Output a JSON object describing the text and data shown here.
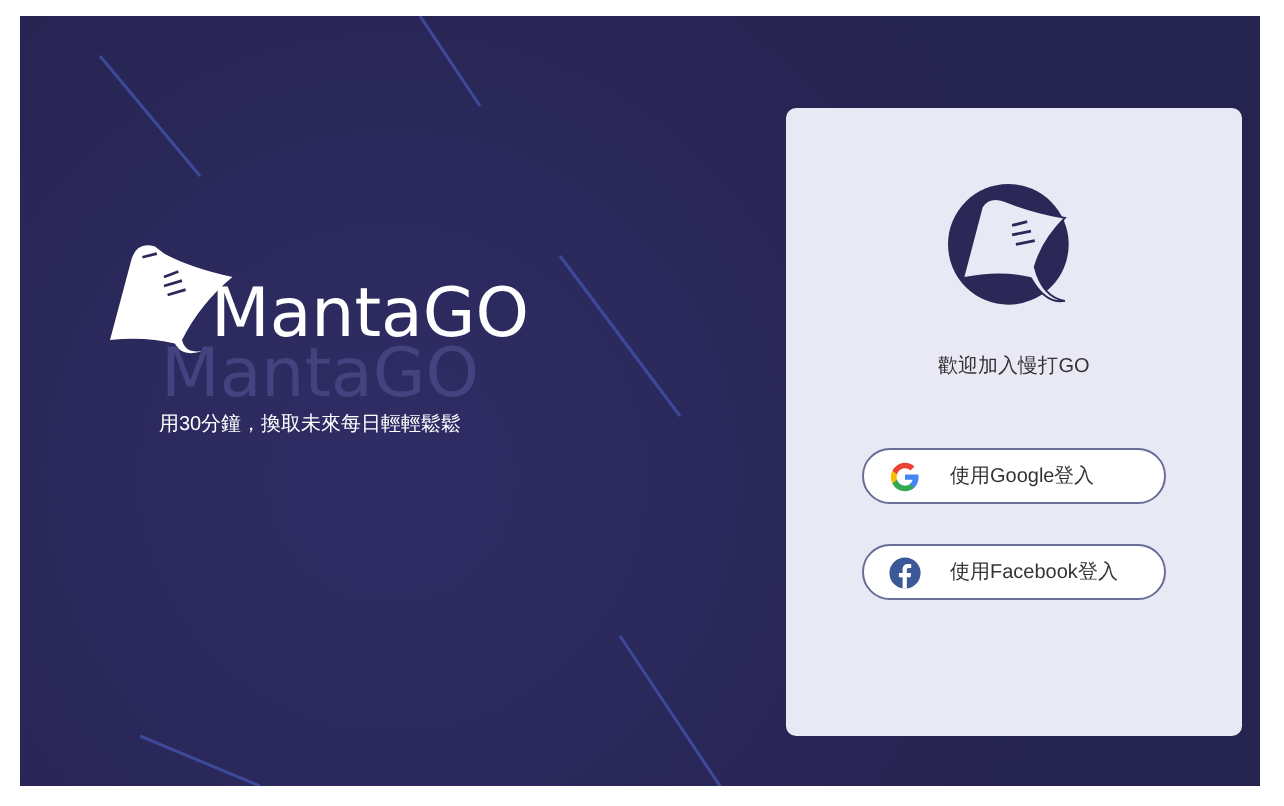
{
  "brand": {
    "name": "MantaGO",
    "echo": "MantaGO",
    "tagline": "用30分鐘，換取未來每日輕輕鬆鬆"
  },
  "card": {
    "welcome": "歡迎加入慢打GO",
    "buttons": [
      {
        "kind": "google",
        "label": "使用Google登入"
      },
      {
        "kind": "facebook",
        "label": "使用Facebook登入"
      }
    ]
  }
}
